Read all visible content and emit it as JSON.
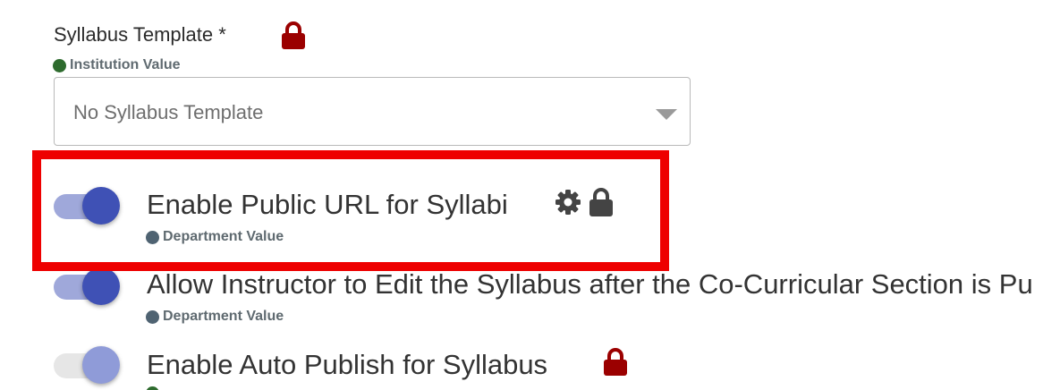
{
  "syllabus_template": {
    "label": "Syllabus Template *",
    "source": "Institution Value",
    "source_color": "#2e6b2e",
    "lock_icon": "lock-icon",
    "lock_color": "#9b0000",
    "select_value": "No Syllabus Template",
    "caret_icon": "chevron-down-icon"
  },
  "settings": [
    {
      "label": "Enable Public URL for Syllabi",
      "source": "Department Value",
      "source_color": "#4f6372",
      "enabled": true,
      "icons": [
        "gear-icon",
        "lock-icon"
      ],
      "icon_color": "#444444"
    },
    {
      "label": "Allow Instructor to Edit the Syllabus after the Co-Curricular Section is Pu",
      "source": "Department Value",
      "source_color": "#4f6372",
      "enabled": true
    },
    {
      "label": "Enable Auto Publish for Syllabus",
      "enabled": true,
      "disabled_look": true,
      "icons": [
        "lock-icon"
      ],
      "icon_color": "#9b0000"
    }
  ],
  "colors": {
    "toggle_thumb_on": "#3f51b5",
    "toggle_track_on": "#9fa8da",
    "toggle_thumb_faded": "#8f9bd8",
    "toggle_track_faded": "#e6e6e6",
    "highlight": "#ee0000"
  }
}
